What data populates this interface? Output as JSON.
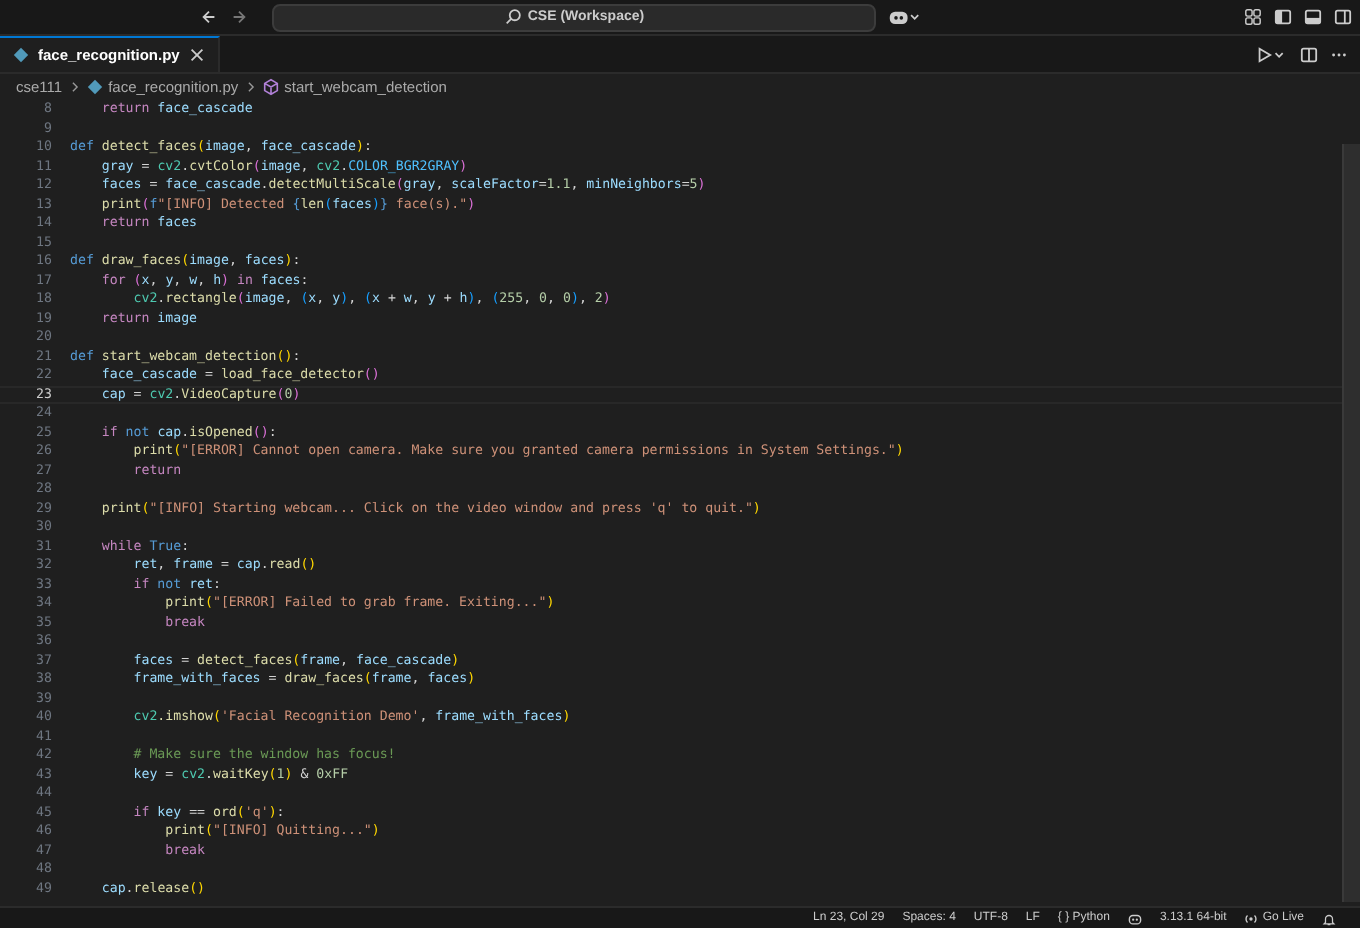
{
  "window": {
    "title": "CSE (Workspace)"
  },
  "tabs": [
    {
      "label": "face_recognition.py",
      "selected": true
    }
  ],
  "breadcrumb": [
    {
      "text": "cse111",
      "kind": "folder"
    },
    {
      "text": "face_recognition.py",
      "kind": "file"
    },
    {
      "text": "start_webcam_detection",
      "kind": "symbol"
    }
  ],
  "editor": {
    "lines": [
      {
        "number": "8",
        "current": false,
        "tokens": [
          {
            "text": "    return",
            "kind": "kw"
          },
          {
            "text": " face_cascade",
            "kind": "var"
          }
        ]
      },
      {
        "number": "9",
        "current": false
      },
      {
        "number": "10",
        "current": false,
        "tokens": [
          {
            "text": "def",
            "kind": "def"
          },
          {
            "text": " detect_faces",
            "kind": "fn"
          },
          {
            "text": "(",
            "kind": "b1"
          },
          {
            "text": "image",
            "kind": "var"
          },
          {
            "text": ", ",
            "kind": "p"
          },
          {
            "text": "face_cascade",
            "kind": "var"
          },
          {
            "text": ")",
            "kind": "b1"
          },
          {
            "text": ":",
            "kind": "p"
          }
        ]
      },
      {
        "number": "11",
        "current": false,
        "tokens": [
          {
            "text": "    gray",
            "kind": "var"
          },
          {
            "text": " = ",
            "kind": "p"
          },
          {
            "text": "cv2",
            "kind": "cls"
          },
          {
            "text": ".",
            "kind": "p"
          },
          {
            "text": "cvtColor",
            "kind": "fn"
          },
          {
            "text": "(",
            "kind": "b2"
          },
          {
            "text": "image",
            "kind": "var"
          },
          {
            "text": ", ",
            "kind": "p"
          },
          {
            "text": "cv2",
            "kind": "cls"
          },
          {
            "text": ".",
            "kind": "p"
          },
          {
            "text": "COLOR_BGR2GRAY",
            "kind": "const"
          },
          {
            "text": ")",
            "kind": "b2"
          }
        ]
      },
      {
        "number": "12",
        "current": false,
        "tokens": [
          {
            "text": "    faces",
            "kind": "var"
          },
          {
            "text": " = ",
            "kind": "p"
          },
          {
            "text": "face_cascade",
            "kind": "var"
          },
          {
            "text": ".",
            "kind": "p"
          },
          {
            "text": "detectMultiScale",
            "kind": "fn"
          },
          {
            "text": "(",
            "kind": "b2"
          },
          {
            "text": "gray",
            "kind": "var"
          },
          {
            "text": ", ",
            "kind": "p"
          },
          {
            "text": "scaleFactor",
            "kind": "var"
          },
          {
            "text": "=",
            "kind": "p"
          },
          {
            "text": "1.1",
            "kind": "num"
          },
          {
            "text": ", ",
            "kind": "p"
          },
          {
            "text": "minNeighbors",
            "kind": "var"
          },
          {
            "text": "=",
            "kind": "p"
          },
          {
            "text": "5",
            "kind": "num"
          },
          {
            "text": ")",
            "kind": "b2"
          }
        ]
      },
      {
        "number": "13",
        "current": false,
        "tokens": [
          {
            "text": "    print",
            "kind": "fn"
          },
          {
            "text": "(",
            "kind": "b2"
          },
          {
            "text": "f",
            "kind": "def"
          },
          {
            "text": "\"[INFO] Detected ",
            "kind": "str"
          },
          {
            "text": "{",
            "kind": "def"
          },
          {
            "text": "len",
            "kind": "fn"
          },
          {
            "text": "(",
            "kind": "b3"
          },
          {
            "text": "faces",
            "kind": "var"
          },
          {
            "text": ")",
            "kind": "b3"
          },
          {
            "text": "}",
            "kind": "def"
          },
          {
            "text": " face(s).\"",
            "kind": "str"
          },
          {
            "text": ")",
            "kind": "b2"
          }
        ]
      },
      {
        "number": "14",
        "current": false,
        "tokens": [
          {
            "text": "    return",
            "kind": "kw"
          },
          {
            "text": " faces",
            "kind": "var"
          }
        ]
      },
      {
        "number": "15",
        "current": false
      },
      {
        "number": "16",
        "current": false,
        "tokens": [
          {
            "text": "def",
            "kind": "def"
          },
          {
            "text": " draw_faces",
            "kind": "fn"
          },
          {
            "text": "(",
            "kind": "b1"
          },
          {
            "text": "image",
            "kind": "var"
          },
          {
            "text": ", ",
            "kind": "p"
          },
          {
            "text": "faces",
            "kind": "var"
          },
          {
            "text": ")",
            "kind": "b1"
          },
          {
            "text": ":",
            "kind": "p"
          }
        ]
      },
      {
        "number": "17",
        "current": false,
        "tokens": [
          {
            "text": "    for",
            "kind": "kw"
          },
          {
            "text": " (",
            "kind": "b2"
          },
          {
            "text": "x",
            "kind": "var"
          },
          {
            "text": ", ",
            "kind": "p"
          },
          {
            "text": "y",
            "kind": "var"
          },
          {
            "text": ", ",
            "kind": "p"
          },
          {
            "text": "w",
            "kind": "var"
          },
          {
            "text": ", ",
            "kind": "p"
          },
          {
            "text": "h",
            "kind": "var"
          },
          {
            "text": ")",
            "kind": "b2"
          },
          {
            "text": " in",
            "kind": "kw"
          },
          {
            "text": " faces",
            "kind": "var"
          },
          {
            "text": ":",
            "kind": "p"
          }
        ]
      },
      {
        "number": "18",
        "current": false,
        "tokens": [
          {
            "text": "        cv2",
            "kind": "cls"
          },
          {
            "text": ".",
            "kind": "p"
          },
          {
            "text": "rectangle",
            "kind": "fn"
          },
          {
            "text": "(",
            "kind": "b2"
          },
          {
            "text": "image",
            "kind": "var"
          },
          {
            "text": ", ",
            "kind": "p"
          },
          {
            "text": "(",
            "kind": "b3"
          },
          {
            "text": "x",
            "kind": "var"
          },
          {
            "text": ", ",
            "kind": "p"
          },
          {
            "text": "y",
            "kind": "var"
          },
          {
            "text": ")",
            "kind": "b3"
          },
          {
            "text": ", ",
            "kind": "p"
          },
          {
            "text": "(",
            "kind": "b3"
          },
          {
            "text": "x",
            "kind": "var"
          },
          {
            "text": " + ",
            "kind": "p"
          },
          {
            "text": "w",
            "kind": "var"
          },
          {
            "text": ", ",
            "kind": "p"
          },
          {
            "text": "y",
            "kind": "var"
          },
          {
            "text": " + ",
            "kind": "p"
          },
          {
            "text": "h",
            "kind": "var"
          },
          {
            "text": ")",
            "kind": "b3"
          },
          {
            "text": ", ",
            "kind": "p"
          },
          {
            "text": "(",
            "kind": "b3"
          },
          {
            "text": "255",
            "kind": "num"
          },
          {
            "text": ", ",
            "kind": "p"
          },
          {
            "text": "0",
            "kind": "num"
          },
          {
            "text": ", ",
            "kind": "p"
          },
          {
            "text": "0",
            "kind": "num"
          },
          {
            "text": ")",
            "kind": "b3"
          },
          {
            "text": ", ",
            "kind": "p"
          },
          {
            "text": "2",
            "kind": "num"
          },
          {
            "text": ")",
            "kind": "b2"
          }
        ]
      },
      {
        "number": "19",
        "current": false,
        "tokens": [
          {
            "text": "    return",
            "kind": "kw"
          },
          {
            "text": " image",
            "kind": "var"
          }
        ]
      },
      {
        "number": "20",
        "current": false
      },
      {
        "number": "21",
        "current": false,
        "tokens": [
          {
            "text": "def",
            "kind": "def"
          },
          {
            "text": " start_webcam_detection",
            "kind": "fn"
          },
          {
            "text": "()",
            "kind": "b1"
          },
          {
            "text": ":",
            "kind": "p"
          }
        ]
      },
      {
        "number": "22",
        "current": false,
        "tokens": [
          {
            "text": "    face_cascade",
            "kind": "var"
          },
          {
            "text": " = ",
            "kind": "p"
          },
          {
            "text": "load_face_detector",
            "kind": "fn"
          },
          {
            "text": "()",
            "kind": "b2"
          }
        ]
      },
      {
        "number": "23",
        "current": true,
        "tokens": [
          {
            "text": "    cap",
            "kind": "var"
          },
          {
            "text": " = ",
            "kind": "p"
          },
          {
            "text": "cv2",
            "kind": "cls"
          },
          {
            "text": ".",
            "kind": "p"
          },
          {
            "text": "VideoCapture",
            "kind": "fn"
          },
          {
            "text": "(",
            "kind": "b2"
          },
          {
            "text": "0",
            "kind": "num"
          },
          {
            "text": ")",
            "kind": "b2"
          }
        ]
      },
      {
        "number": "24",
        "current": false
      },
      {
        "number": "25",
        "current": false,
        "tokens": [
          {
            "text": "    if",
            "kind": "kw"
          },
          {
            "text": " not",
            "kind": "def"
          },
          {
            "text": " cap",
            "kind": "var"
          },
          {
            "text": ".",
            "kind": "p"
          },
          {
            "text": "isOpened",
            "kind": "fn"
          },
          {
            "text": "()",
            "kind": "b2"
          },
          {
            "text": ":",
            "kind": "p"
          }
        ]
      },
      {
        "number": "26",
        "current": false,
        "tokens": [
          {
            "text": "        print",
            "kind": "fn"
          },
          {
            "text": "(",
            "kind": "b1"
          },
          {
            "text": "\"[ERROR] Cannot open camera. Make sure you granted camera permissions in System Settings.\"",
            "kind": "str"
          },
          {
            "text": ")",
            "kind": "b1"
          }
        ]
      },
      {
        "number": "27",
        "current": false,
        "tokens": [
          {
            "text": "        return",
            "kind": "kw"
          }
        ]
      },
      {
        "number": "28",
        "current": false
      },
      {
        "number": "29",
        "current": false,
        "tokens": [
          {
            "text": "    print",
            "kind": "fn"
          },
          {
            "text": "(",
            "kind": "b1"
          },
          {
            "text": "\"[INFO] Starting webcam... Click on the video window and press 'q' to quit.\"",
            "kind": "str"
          },
          {
            "text": ")",
            "kind": "b1"
          }
        ]
      },
      {
        "number": "30",
        "current": false
      },
      {
        "number": "31",
        "current": false,
        "tokens": [
          {
            "text": "    while",
            "kind": "kw"
          },
          {
            "text": " True",
            "kind": "def"
          },
          {
            "text": ":",
            "kind": "p"
          }
        ]
      },
      {
        "number": "32",
        "current": false,
        "tokens": [
          {
            "text": "        ret",
            "kind": "var"
          },
          {
            "text": ", ",
            "kind": "p"
          },
          {
            "text": "frame",
            "kind": "var"
          },
          {
            "text": " = ",
            "kind": "p"
          },
          {
            "text": "cap",
            "kind": "var"
          },
          {
            "text": ".",
            "kind": "p"
          },
          {
            "text": "read",
            "kind": "fn"
          },
          {
            "text": "()",
            "kind": "b1"
          }
        ]
      },
      {
        "number": "33",
        "current": false,
        "tokens": [
          {
            "text": "        if",
            "kind": "kw"
          },
          {
            "text": " not",
            "kind": "def"
          },
          {
            "text": " ret",
            "kind": "var"
          },
          {
            "text": ":",
            "kind": "p"
          }
        ]
      },
      {
        "number": "34",
        "current": false,
        "tokens": [
          {
            "text": "            print",
            "kind": "fn"
          },
          {
            "text": "(",
            "kind": "b1"
          },
          {
            "text": "\"[ERROR] Failed to grab frame. Exiting...\"",
            "kind": "str"
          },
          {
            "text": ")",
            "kind": "b1"
          }
        ]
      },
      {
        "number": "35",
        "current": false,
        "tokens": [
          {
            "text": "            break",
            "kind": "kw"
          }
        ]
      },
      {
        "number": "36",
        "current": false
      },
      {
        "number": "37",
        "current": false,
        "tokens": [
          {
            "text": "        faces",
            "kind": "var"
          },
          {
            "text": " = ",
            "kind": "p"
          },
          {
            "text": "detect_faces",
            "kind": "fn"
          },
          {
            "text": "(",
            "kind": "b1"
          },
          {
            "text": "frame",
            "kind": "var"
          },
          {
            "text": ", ",
            "kind": "p"
          },
          {
            "text": "face_cascade",
            "kind": "var"
          },
          {
            "text": ")",
            "kind": "b1"
          }
        ]
      },
      {
        "number": "38",
        "current": false,
        "tokens": [
          {
            "text": "        frame_with_faces",
            "kind": "var"
          },
          {
            "text": " = ",
            "kind": "p"
          },
          {
            "text": "draw_faces",
            "kind": "fn"
          },
          {
            "text": "(",
            "kind": "b1"
          },
          {
            "text": "frame",
            "kind": "var"
          },
          {
            "text": ", ",
            "kind": "p"
          },
          {
            "text": "faces",
            "kind": "var"
          },
          {
            "text": ")",
            "kind": "b1"
          }
        ]
      },
      {
        "number": "39",
        "current": false
      },
      {
        "number": "40",
        "current": false,
        "tokens": [
          {
            "text": "        cv2",
            "kind": "cls"
          },
          {
            "text": ".imshow",
            "kind": "fn"
          },
          {
            "text": "(",
            "kind": "b1"
          },
          {
            "text": "'Facial Recognition Demo'",
            "kind": "str"
          },
          {
            "text": ", ",
            "kind": "p"
          },
          {
            "text": "frame_with_faces",
            "kind": "var"
          },
          {
            "text": ")",
            "kind": "b1"
          }
        ]
      },
      {
        "number": "41",
        "current": false
      },
      {
        "number": "42",
        "current": false,
        "tokens": [
          {
            "text": "        # Make sure the window has focus!",
            "kind": "cm"
          }
        ]
      },
      {
        "number": "43",
        "current": false,
        "tokens": [
          {
            "text": "        key",
            "kind": "var"
          },
          {
            "text": " = ",
            "kind": "p"
          },
          {
            "text": "cv2",
            "kind": "cls"
          },
          {
            "text": ".",
            "kind": "p"
          },
          {
            "text": "waitKey",
            "kind": "fn"
          },
          {
            "text": "(",
            "kind": "b1"
          },
          {
            "text": "1",
            "kind": "num"
          },
          {
            "text": ")",
            "kind": "b1"
          },
          {
            "text": " & ",
            "kind": "p"
          },
          {
            "text": "0xFF",
            "kind": "num"
          }
        ]
      },
      {
        "number": "44",
        "current": false
      },
      {
        "number": "45",
        "current": false,
        "tokens": [
          {
            "text": "        if",
            "kind": "kw"
          },
          {
            "text": " key",
            "kind": "var"
          },
          {
            "text": " == ",
            "kind": "p"
          },
          {
            "text": "ord",
            "kind": "fn"
          },
          {
            "text": "(",
            "kind": "b1"
          },
          {
            "text": "'q'",
            "kind": "str"
          },
          {
            "text": ")",
            "kind": "b1"
          },
          {
            "text": ":",
            "kind": "p"
          }
        ]
      },
      {
        "number": "46",
        "current": false,
        "tokens": [
          {
            "text": "            print",
            "kind": "fn"
          },
          {
            "text": "(",
            "kind": "b1"
          },
          {
            "text": "\"[INFO] Quitting...\"",
            "kind": "str"
          },
          {
            "text": ")",
            "kind": "b1"
          }
        ]
      },
      {
        "number": "47",
        "current": false,
        "tokens": [
          {
            "text": "            break",
            "kind": "kw"
          }
        ]
      },
      {
        "number": "48",
        "current": false
      },
      {
        "number": "49",
        "current": false,
        "tokens": [
          {
            "text": "    cap",
            "kind": "var"
          },
          {
            "text": ".",
            "kind": "p"
          },
          {
            "text": "release",
            "kind": "fn"
          },
          {
            "text": "()",
            "kind": "b1"
          }
        ]
      }
    ]
  },
  "status_bar": [
    {
      "kind": "text",
      "text": "Ln 23, Col 29"
    },
    {
      "kind": "text",
      "text": "Spaces: 4"
    },
    {
      "kind": "text",
      "text": "UTF-8"
    },
    {
      "kind": "text",
      "text": "LF"
    },
    {
      "kind": "text",
      "text": "{ } Python"
    },
    {
      "kind": "copilot"
    },
    {
      "kind": "text",
      "text": "3.13.1 64-bit"
    },
    {
      "kind": "live",
      "text": "Go Live"
    },
    {
      "kind": "bell"
    }
  ]
}
